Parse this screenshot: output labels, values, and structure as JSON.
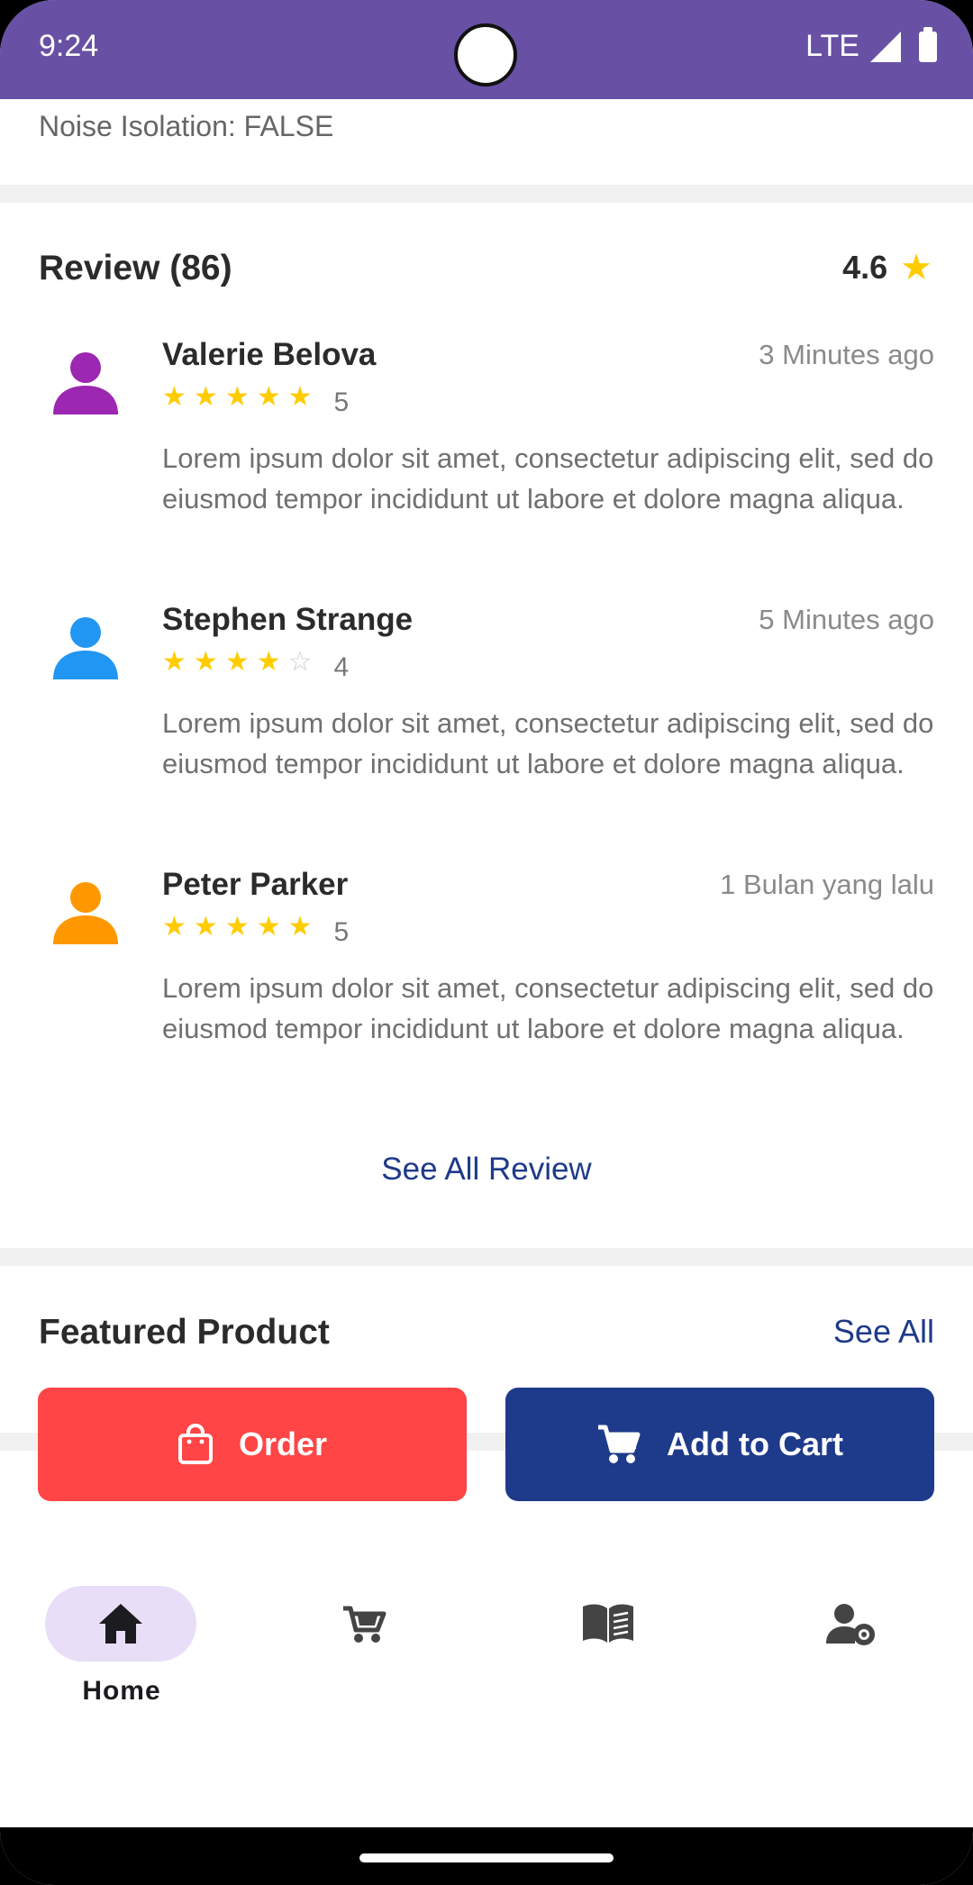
{
  "status_bar": {
    "time": "9:24",
    "network": "LTE"
  },
  "spec": {
    "previous_line": "Noise Isolation: FALSE"
  },
  "reviews_section": {
    "title": "Review (86)",
    "average_rating": "4.6",
    "reviews": [
      {
        "name": "Valerie Belova",
        "time": "3 Minutes ago",
        "stars": 5,
        "score": "5",
        "avatar_color": "#9c27b0",
        "text": "Lorem ipsum dolor sit amet, consectetur adipiscing elit, sed do eiusmod tempor incididunt ut labore et dolore magna aliqua."
      },
      {
        "name": "Stephen Strange",
        "time": "5 Minutes ago",
        "stars": 4,
        "score": "4",
        "avatar_color": "#2196f3",
        "text": "Lorem ipsum dolor sit amet, consectetur adipiscing elit, sed do eiusmod tempor incididunt ut labore et dolore magna aliqua."
      },
      {
        "name": "Peter Parker",
        "time": "1 Bulan yang lalu",
        "stars": 5,
        "score": "5",
        "avatar_color": "#ff9800",
        "text": "Lorem ipsum dolor sit amet, consectetur adipiscing elit, sed do eiusmod tempor incididunt ut labore et dolore magna aliqua."
      }
    ],
    "see_all_label": "See All Review"
  },
  "featured": {
    "title": "Featured Product",
    "see_all_label": "See All"
  },
  "actions": {
    "order_label": "Order",
    "add_to_cart_label": "Add to Cart"
  },
  "bottom_nav": {
    "items": [
      {
        "label": "Home",
        "icon": "home-icon",
        "active": true
      },
      {
        "label": "",
        "icon": "cart-icon",
        "active": false
      },
      {
        "label": "",
        "icon": "book-icon",
        "active": false
      },
      {
        "label": "",
        "icon": "user-settings-icon",
        "active": false
      }
    ]
  },
  "colors": {
    "status_bar": "#6850a4",
    "accent_blue": "#1e3a8a",
    "order_red": "#ff4545",
    "star_yellow": "#ffcc00",
    "nav_pill": "#e8def8"
  }
}
